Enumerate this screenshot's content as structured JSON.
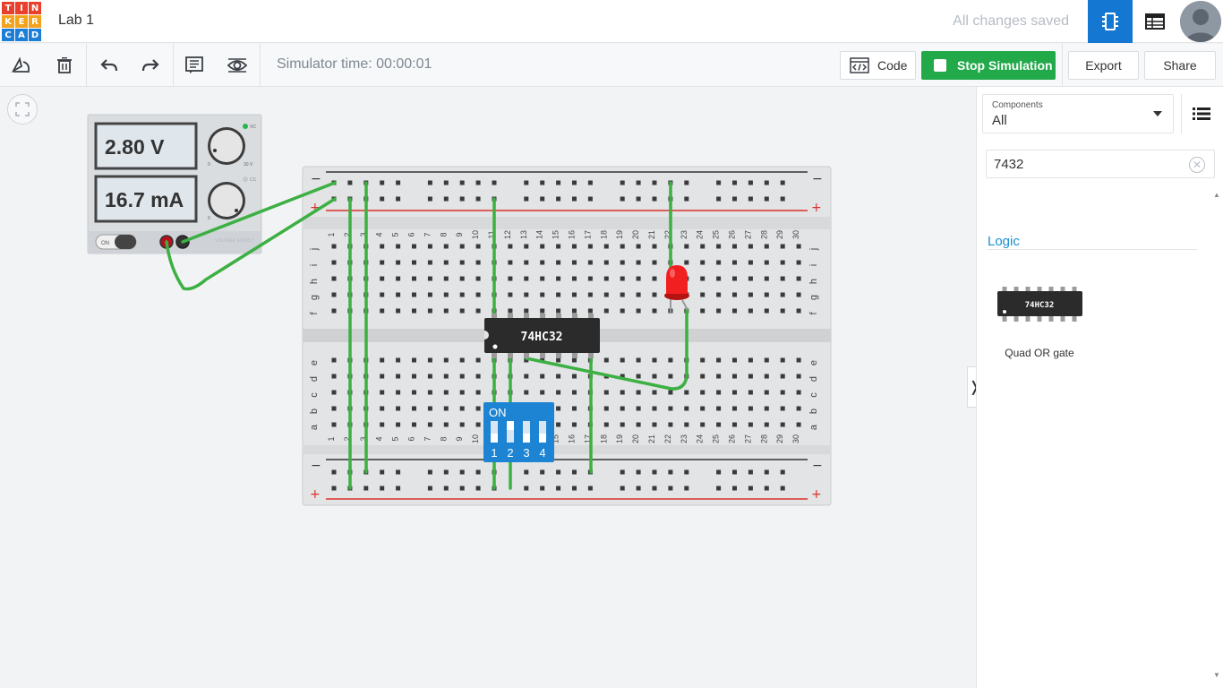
{
  "app": {
    "logo_letters": [
      "T",
      "I",
      "N",
      "K",
      "E",
      "R",
      "C",
      "A",
      "D"
    ],
    "logo_colors": [
      "#e8402d",
      "#e8402d",
      "#e8402d",
      "#f2a21b",
      "#f2a21b",
      "#f2a21b",
      "#1c7ed6",
      "#1c7ed6",
      "#1c7ed6"
    ],
    "project_title": "Lab 1",
    "save_status": "All changes saved"
  },
  "topbar_icons": {
    "circuit_view": "chip-icon",
    "schematic_view": "table-icon",
    "user": "user-avatar"
  },
  "toolbar": {
    "rotate": "rotate-icon",
    "delete": "trash-icon",
    "undo": "undo-icon",
    "redo": "redo-icon",
    "notes": "notes-icon",
    "visibility": "eye-icon",
    "sim_time": "Simulator time: 00:00:01",
    "code_label": "Code",
    "stop_label": "Stop Simulation",
    "export_label": "Export",
    "share_label": "Share"
  },
  "circuit": {
    "power_supply": {
      "voltage": "2.80 V",
      "current": "16.7 mA",
      "switch_label": "ON",
      "knob1_min": "0",
      "knob1_max": "30 V",
      "knob2_min": "0",
      "vc_label": "VC",
      "cc_label": "CC",
      "brand": "VOLTAGE SUPPLY"
    },
    "breadboard": {
      "columns": [
        "1",
        "2",
        "3",
        "4",
        "5",
        "6",
        "7",
        "8",
        "9",
        "10",
        "11",
        "12",
        "13",
        "14",
        "15",
        "16",
        "17",
        "18",
        "19",
        "20",
        "21",
        "22",
        "23",
        "24",
        "25",
        "26",
        "27",
        "28",
        "29",
        "30"
      ],
      "rows_top": [
        "j",
        "i",
        "h",
        "g",
        "f"
      ],
      "rows_bottom": [
        "e",
        "d",
        "c",
        "b",
        "a"
      ],
      "minus": "−",
      "plus": "+"
    },
    "ic": {
      "label": "74HC32"
    },
    "dip": {
      "label": "ON",
      "numbers": [
        "1",
        "2",
        "3",
        "4"
      ]
    }
  },
  "panel": {
    "select_label": "Components",
    "select_value": "All",
    "search_value": "7432",
    "category": "Logic",
    "component_chip_label": "74HC32",
    "component_name": "Quad OR gate"
  },
  "colors": {
    "accent_blue": "#1477d1",
    "sim_green": "#22a94a",
    "wire_green": "#3cb043",
    "rail_red": "#d9302c",
    "led_red": "#f11f1f"
  }
}
